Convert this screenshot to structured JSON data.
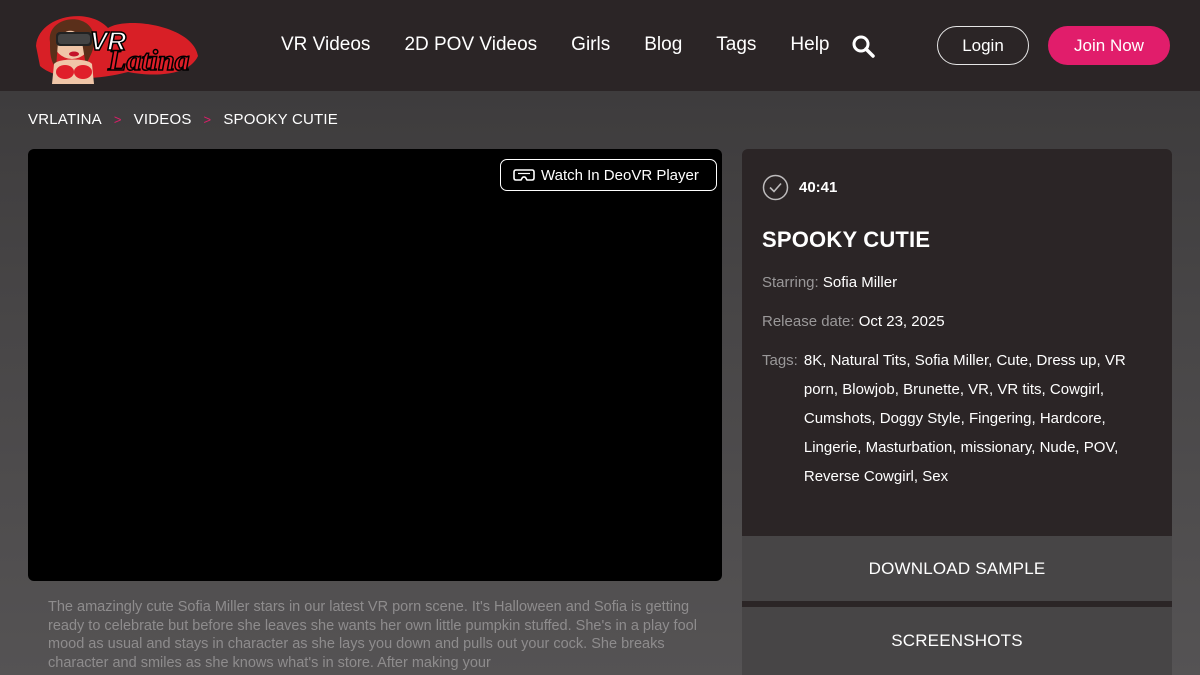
{
  "header": {
    "logo_text": "VRLatina",
    "nav": [
      {
        "label": "VR Videos"
      },
      {
        "label": "2D POV Videos"
      },
      {
        "label": "Girls"
      },
      {
        "label": "Blog"
      },
      {
        "label": "Tags"
      },
      {
        "label": "Help"
      }
    ],
    "search_icon": "search-icon",
    "login_label": "Login",
    "join_label": "Join Now"
  },
  "breadcrumb": {
    "items": [
      "VRLATINA",
      "VIDEOS",
      "SPOOKY CUTIE"
    ],
    "separator": ">"
  },
  "player": {
    "deovr_label": "Watch In DeoVR Player",
    "deovr_icon": "vr-headset-icon"
  },
  "description": "The amazingly cute Sofia Miller stars in our latest VR porn scene. It's Halloween and Sofia is getting ready to celebrate but before she leaves she wants her own little pumpkin stuffed. She's in a play fool mood as usual and stays in character as she lays you down and pulls out your cock. She breaks character and smiles as she knows what's in store. After making your",
  "info": {
    "duration": "40:41",
    "duration_icon": "check-circle-icon",
    "title": "SPOOKY CUTIE",
    "starring_label": "Starring:",
    "starring_value": "Sofia Miller",
    "release_label": "Release date:",
    "release_value": "Oct 23, 2025",
    "tags_label": "Tags:",
    "tags": [
      "8K",
      "Natural Tits",
      "Sofia Miller",
      "Cute",
      "Dress up",
      "VR porn",
      "Blowjob",
      "Brunette",
      "VR",
      "VR tits",
      "Cowgirl",
      "Cumshots",
      "Doggy Style",
      "Fingering",
      "Hardcore",
      "Lingerie",
      "Masturbation",
      "missionary",
      "Nude",
      "POV",
      "Reverse Cowgirl",
      "Sex"
    ]
  },
  "actions": {
    "download_label": "DOWNLOAD SAMPLE",
    "screenshots_label": "SCREENSHOTS"
  },
  "colors": {
    "accent": "#e11d6b",
    "header_bg": "#2b2526",
    "panel_bg": "#2b2526"
  }
}
